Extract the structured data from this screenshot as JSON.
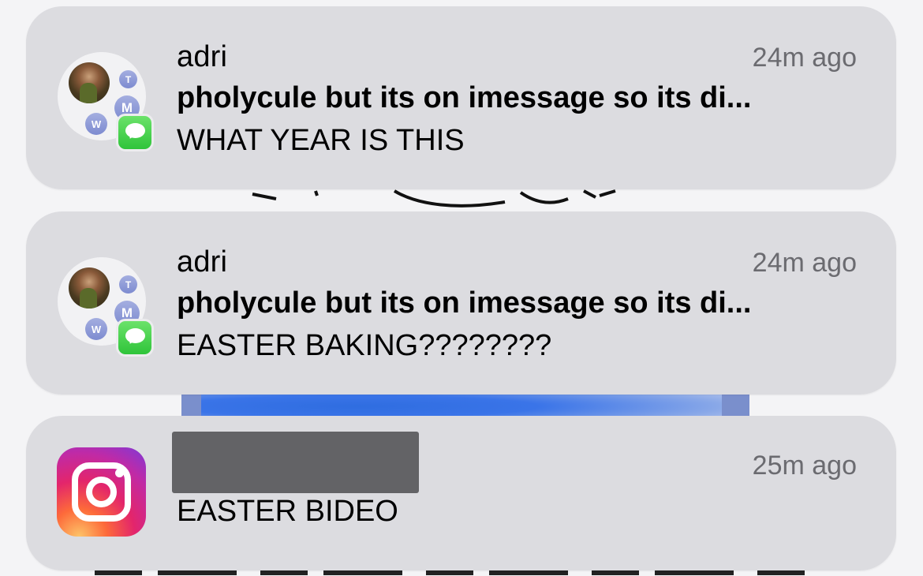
{
  "notifications": [
    {
      "app_icon": "messages-icon",
      "sender": "adri",
      "time": "24m ago",
      "title": "pholycule but its on imessage so its di...",
      "body": "WHAT YEAR IS THIS",
      "members": [
        "T",
        "M",
        "W"
      ]
    },
    {
      "app_icon": "messages-icon",
      "sender": "adri",
      "time": "24m ago",
      "title": "pholycule but its on imessage so its di...",
      "body": "EASTER BAKING????????",
      "members": [
        "T",
        "M",
        "W"
      ]
    },
    {
      "app_icon": "instagram-icon",
      "sender": "",
      "time": "25m ago",
      "body": "EASTER BIDEO"
    }
  ],
  "colors": {
    "card": "#dcdce0",
    "messages_green": "#34c759",
    "time_gray": "#6b6b70",
    "redaction": "#636366"
  }
}
